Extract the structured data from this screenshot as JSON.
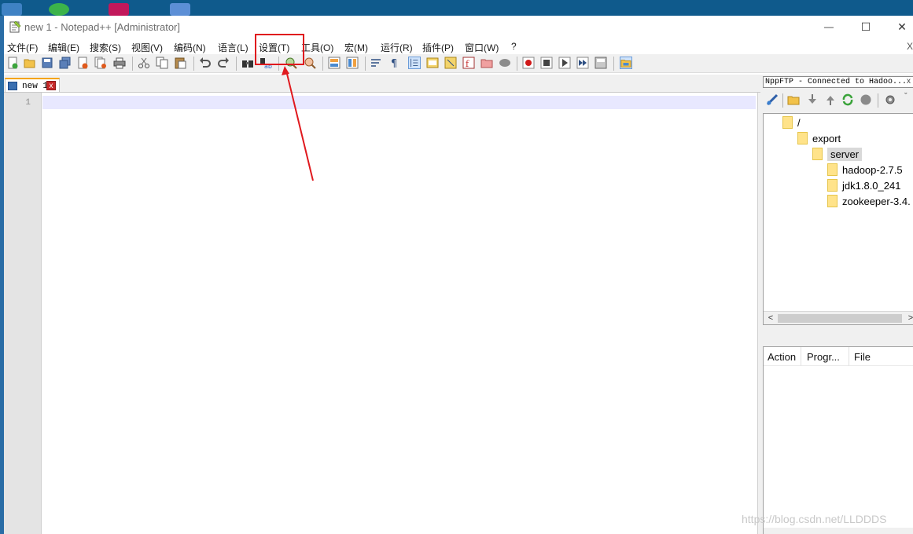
{
  "window": {
    "title": "new 1 - Notepad++ [Administrator]",
    "controls": {
      "minimize": "—",
      "maximize": "☐",
      "close": "✕"
    }
  },
  "menu": {
    "items": [
      "文件(F)",
      "编辑(E)",
      "搜索(S)",
      "视图(V)",
      "编码(N)",
      "语言(L)",
      "设置(T)",
      "工具(O)",
      "宏(M)",
      "运行(R)",
      "插件(P)",
      "窗口(W)",
      "?"
    ],
    "close": "X"
  },
  "tabs": [
    {
      "label": "new 1",
      "close": "x",
      "active": true
    }
  ],
  "editor": {
    "line_numbers": [
      "1"
    ],
    "current_line_color": "#e8e8ff"
  },
  "ftp": {
    "title": "NppFTP - Connected to Hadoo...",
    "title_close": "x",
    "tree": [
      {
        "label": "/",
        "depth": 0
      },
      {
        "label": "export",
        "depth": 1
      },
      {
        "label": "server",
        "depth": 2,
        "selected": true
      },
      {
        "label": "hadoop-2.7.5",
        "depth": 3
      },
      {
        "label": "jdk1.8.0_241",
        "depth": 3
      },
      {
        "label": "zookeeper-3.4.",
        "depth": 3
      }
    ],
    "scroll": {
      "left": "<",
      "right": ">"
    },
    "queue_columns": [
      "Action",
      "Progr...",
      "File"
    ]
  },
  "annotation": {
    "highlight_target": "设置(T)",
    "color": "#e0191e"
  },
  "watermark": "https://blog.csdn.net/LLDDDS"
}
